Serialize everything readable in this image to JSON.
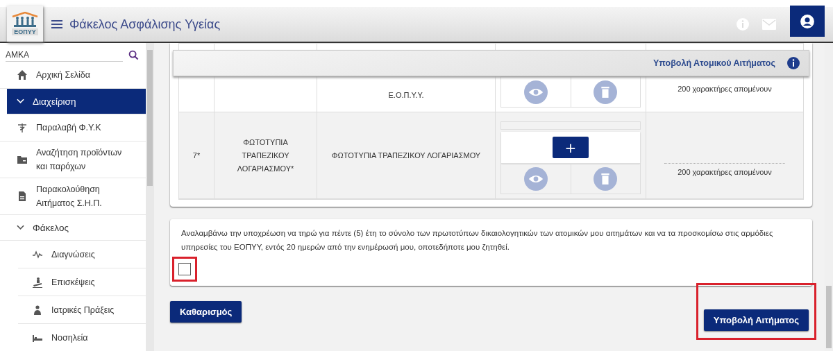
{
  "app": {
    "title": "Φάκελος Ασφάλισης Υγείας",
    "logo_text": "ΕΟΠΥΥ"
  },
  "sidebar": {
    "search": {
      "placeholder": "ΑΜΚΑ"
    },
    "items": [
      {
        "kind": "item",
        "label": "Αρχική Σελίδα",
        "selected": false
      },
      {
        "kind": "group",
        "label": "Διαχείριση",
        "expanded": true,
        "selected": true
      },
      {
        "kind": "item",
        "label": "Παραλαβή Φ.Υ.Κ",
        "selected": false
      },
      {
        "kind": "item",
        "label": "Αναζήτηση προϊόντων και παρόχων",
        "selected": false
      },
      {
        "kind": "item",
        "label": "Παρακολούθηση Αιτήματος Σ.Η.Π.",
        "selected": false
      },
      {
        "kind": "group",
        "label": "Φάκελος",
        "expanded": true,
        "selected": false,
        "children": [
          {
            "label": "Διαγνώσεις"
          },
          {
            "label": "Επισκέψεις"
          },
          {
            "label": "Ιατρικές Πράξεις"
          },
          {
            "label": "Νοσηλεία"
          }
        ]
      }
    ]
  },
  "panel": {
    "title": "Υποβολή Ατομικού Αιτήματος"
  },
  "documents": [
    {
      "description": "Ε.Ο.Π.Υ.Υ.",
      "remaining": "200 χαρακτήρες απομένουν"
    },
    {
      "number": "7*",
      "name": "ΦΩΤΟΤΥΠΙΑ ΤΡΑΠΕΖΙΚΟΥ ΛΟΓΑΡΙΑΣΜΟΥ*",
      "description": "ΦΩΤΟΤΥΠΙΑ ΤΡΑΠΕΖΙΚΟΥ ΛΟΓΑΡΙΑΣΜΟΥ",
      "add_button": "+",
      "remaining": "200 χαρακτήρες απομένουν"
    }
  ],
  "declaration": {
    "text": "Αναλαμβάνω την υποχρέωση να τηρώ για πέντε (5) έτη το σύνολο των πρωτοτύπων δικαιολογητικών των ατομικών μου αιτημάτων και να τα προσκομίσω στις αρμόδιες υπηρεσίες του ΕΟΠΥΥ, εντός 20 ημερών από την ενημέρωσή μου, οποτεδήποτε μου ζητηθεί.",
    "checked": false,
    "highlighted": true
  },
  "buttons": [
    {
      "label": "Καθαρισμός",
      "highlighted": false
    },
    {
      "label": "Υποβολή Αιτήματος",
      "highlighted": true
    }
  ]
}
